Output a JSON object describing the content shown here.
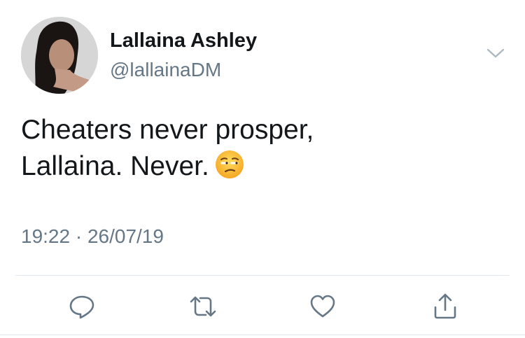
{
  "user": {
    "display_name": "Lallaina Ashley",
    "handle": "@lallainaDM"
  },
  "tweet": {
    "text_line1": "Cheaters never prosper,",
    "text_line2": "Lallaina. Never.",
    "emoji": "unamused-face-emoji",
    "timestamp": "19:22 · 26/07/19"
  },
  "actions": [
    {
      "icon": "reply-icon"
    },
    {
      "icon": "retweet-icon"
    },
    {
      "icon": "like-icon"
    },
    {
      "icon": "share-icon"
    }
  ],
  "menu": {
    "icon": "chevron-down-icon"
  },
  "colors": {
    "text": "#14171a",
    "secondary": "#657786",
    "divider": "#e1e8ed",
    "icon": "#657786"
  }
}
